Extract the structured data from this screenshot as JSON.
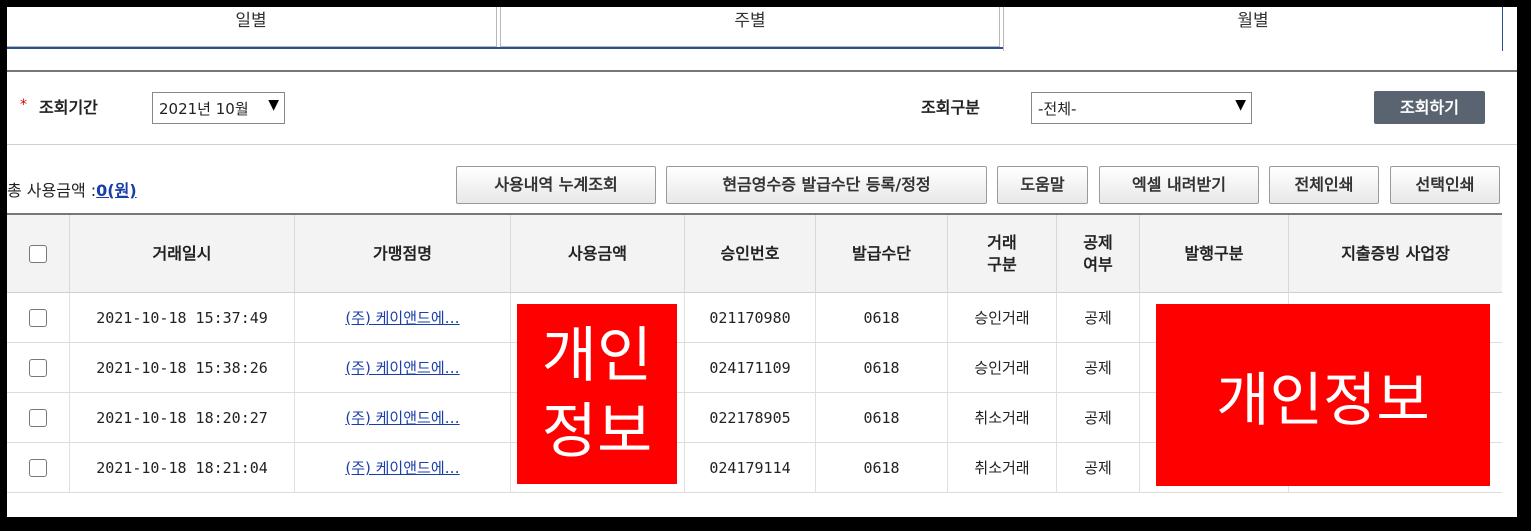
{
  "tabs": [
    "일별",
    "주별",
    "월별"
  ],
  "search": {
    "required_mark": "*",
    "period_label": "조회기간",
    "period_value": "2021년 10월",
    "type_label": "조회구분",
    "type_value": "-전체-",
    "search_button": "조회하기"
  },
  "total": {
    "label": "총 사용금액 :",
    "value": "0(원)"
  },
  "actions": [
    "사용내역 누계조회",
    "현금영수증 발급수단 등록/정정",
    "도움말",
    "엑셀 내려받기",
    "전체인쇄",
    "선택인쇄"
  ],
  "columns": [
    "거래일시",
    "가맹점명",
    "사용금액",
    "승인번호",
    "발급수단",
    "거래\n구분",
    "공제\n여부",
    "발행구분",
    "지출증빙 사업장"
  ],
  "rows": [
    {
      "datetime": "2021-10-18 15:37:49",
      "merchant": "(주) 케이앤드에…",
      "approval": "021170980",
      "method": "0618",
      "type": "승인거래",
      "deduction": "공제"
    },
    {
      "datetime": "2021-10-18 15:38:26",
      "merchant": "(주) 케이앤드에…",
      "approval": "024171109",
      "method": "0618",
      "type": "승인거래",
      "deduction": "공제"
    },
    {
      "datetime": "2021-10-18 18:20:27",
      "merchant": "(주) 케이앤드에…",
      "approval": "022178905",
      "method": "0618",
      "type": "취소거래",
      "deduction": "공제"
    },
    {
      "datetime": "2021-10-18 18:21:04",
      "merchant": "(주) 케이앤드에…",
      "approval": "024179114",
      "method": "0618",
      "type": "취소거래",
      "deduction": "공제"
    }
  ],
  "redactions": {
    "amount": "개인\n정보",
    "issuer": "개인정보"
  },
  "colors": {
    "accent": "#2a4f9a",
    "link": "#1a3ea8",
    "redact": "#ff0000",
    "search_button": "#5a6470"
  }
}
